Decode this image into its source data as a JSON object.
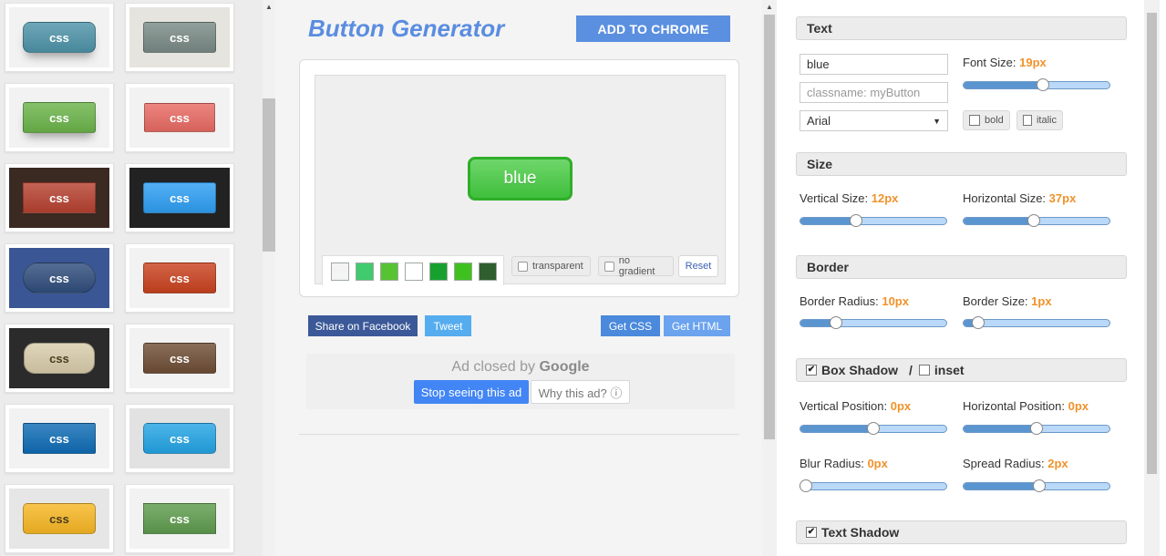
{
  "gallery": {
    "tiles": [
      {
        "label": "css",
        "bg": "#f2f2f2",
        "btn": "#4e93a8",
        "w": 80,
        "h": 34,
        "r": 8,
        "shadow": true
      },
      {
        "label": "css",
        "bg": "#e6e4de",
        "btn": "#7a8a86",
        "w": 80,
        "h": 34,
        "r": 3,
        "shadow": false
      },
      {
        "label": "css",
        "bg": "#f2f2f2",
        "btn": "#6bb44a",
        "w": 80,
        "h": 34,
        "r": 3,
        "shadow": true
      },
      {
        "label": "css",
        "bg": "#f2f2f2",
        "btn": "#e86a63",
        "w": 78,
        "h": 32,
        "r": 2,
        "shadow": false
      },
      {
        "label": "css",
        "bg": "#3a2a22",
        "btn": "#b64130",
        "w": 80,
        "h": 34,
        "r": 0,
        "shadow": false
      },
      {
        "label": "css",
        "bg": "#222222",
        "btn": "#2e9ef2",
        "w": 80,
        "h": 34,
        "r": 3,
        "shadow": false
      },
      {
        "label": "css",
        "bg": "#3a5694",
        "btn": "#2f4d7c",
        "w": 80,
        "h": 34,
        "r": 17,
        "shadow": false
      },
      {
        "label": "css",
        "bg": "#f2f2f2",
        "btn": "#c9421f",
        "w": 80,
        "h": 34,
        "r": 3,
        "shadow": false
      },
      {
        "label": "css",
        "bg": "#2b2b2b",
        "btn": "#d8ccaa",
        "w": 78,
        "h": 34,
        "r": 12,
        "shadow": false
      },
      {
        "label": "css",
        "bg": "#f2f2f2",
        "btn": "#6f4e36",
        "w": 80,
        "h": 34,
        "r": 3,
        "shadow": false
      },
      {
        "label": "css",
        "bg": "#f2f2f2",
        "btn": "#0f6cb5",
        "w": 80,
        "h": 34,
        "r": 2,
        "shadow": false
      },
      {
        "label": "css",
        "bg": "#e2e2e2",
        "btn": "#24a4e4",
        "w": 80,
        "h": 34,
        "r": 5,
        "shadow": false
      },
      {
        "label": "css",
        "bg": "#e6e6e6",
        "btn": "#f7b724",
        "w": 80,
        "h": 34,
        "r": 5,
        "shadow": false
      },
      {
        "label": "css",
        "bg": "#f2f2f2",
        "btn": "#5e9c4e",
        "w": 80,
        "h": 34,
        "r": 0,
        "shadow": false
      }
    ]
  },
  "header": {
    "title": "Button Generator",
    "add_to_chrome": "ADD TO CHROME"
  },
  "preview": {
    "button_text": "blue",
    "swatches": [
      "#f4f4f4",
      "#3fcb6e",
      "#58c332",
      "#ffffff",
      "#16a12e",
      "#3ec11f",
      "#2f5f2e"
    ],
    "transparent_label": "transparent",
    "no_gradient_label": "no gradient",
    "reset_label": "Reset"
  },
  "actions": {
    "facebook": "Share on Facebook",
    "tweet": "Tweet",
    "get_css": "Get CSS",
    "get_html": "Get HTML"
  },
  "ad": {
    "closed_prefix": "Ad closed by",
    "closed_brand": "Google",
    "stop": "Stop seeing this ad",
    "why": "Why this ad? ⓘ"
  },
  "text_section": {
    "title": "Text",
    "text_value": "blue",
    "classname_placeholder": "classname: myButton",
    "font": "Arial",
    "font_size_label": "Font Size:",
    "font_size_value": "19px",
    "font_size_fraction": 0.55,
    "bold_label": "bold",
    "italic_label": "italic"
  },
  "size_section": {
    "title": "Size",
    "vertical_label": "Vertical Size:",
    "vertical_value": "12px",
    "vertical_fraction": 0.37,
    "horizontal_label": "Horizontal Size:",
    "horizontal_value": "37px",
    "horizontal_fraction": 0.48
  },
  "border_section": {
    "title": "Border",
    "radius_label": "Border Radius:",
    "radius_value": "10px",
    "radius_fraction": 0.22,
    "size_label": "Border Size:",
    "size_value": "1px",
    "size_fraction": 0.07
  },
  "shadow_section": {
    "title": "Box Shadow",
    "separator": "/",
    "inset_label": "inset",
    "vpos_label": "Vertical Position:",
    "vpos_value": "0px",
    "vpos_fraction": 0.5,
    "hpos_label": "Horizontal Position:",
    "hpos_value": "0px",
    "hpos_fraction": 0.5,
    "blur_label": "Blur Radius:",
    "blur_value": "0px",
    "blur_fraction": 0.0,
    "spread_label": "Spread Radius:",
    "spread_value": "2px",
    "spread_fraction": 0.52
  },
  "text_shadow_section": {
    "title": "Text Shadow"
  }
}
